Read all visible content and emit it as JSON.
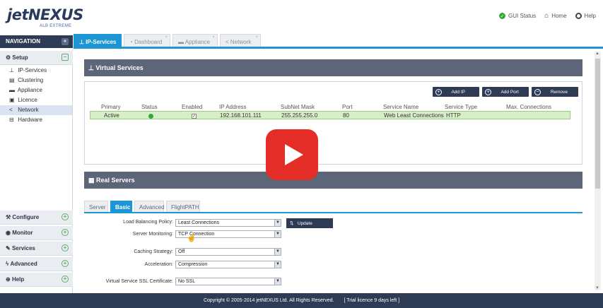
{
  "brand": {
    "logo_main": "jetNEXUS",
    "logo_sub": "ALB EXTREME"
  },
  "toplinks": [
    {
      "label": "GUI Status",
      "icon": "check-circle-icon"
    },
    {
      "label": "Home",
      "icon": "home-icon"
    },
    {
      "label": "Help",
      "icon": "lifebuoy-icon"
    }
  ],
  "nav": {
    "header": "NAVIGATION",
    "collapse_label": "«",
    "setup": {
      "label": "Setup",
      "toggle": "−"
    },
    "setup_items": [
      {
        "label": "IP-Services",
        "icon": "network-icon"
      },
      {
        "label": "Clustering",
        "icon": "server-icon"
      },
      {
        "label": "Appliance",
        "icon": "appliance-icon"
      },
      {
        "label": "Licence",
        "icon": "licence-icon"
      },
      {
        "label": "Network",
        "icon": "share-icon"
      },
      {
        "label": "Hardware",
        "icon": "hardware-icon"
      }
    ],
    "sections": [
      {
        "label": "Configure",
        "icon": "configure-icon",
        "toggle": "+"
      },
      {
        "label": "Monitor",
        "icon": "eye-icon",
        "toggle": "+"
      },
      {
        "label": "Services",
        "icon": "wrench-icon",
        "toggle": "+"
      },
      {
        "label": "Advanced",
        "icon": "bolt-icon",
        "toggle": "+"
      },
      {
        "label": "Help",
        "icon": "lifebuoy-icon",
        "toggle": "+"
      }
    ]
  },
  "tabs": [
    {
      "label": "IP-Services",
      "icon": "network-icon",
      "active": true
    },
    {
      "label": "Dashboard",
      "icon": "dashboard-icon",
      "active": false
    },
    {
      "label": "Appliance",
      "icon": "appliance-icon",
      "active": false
    },
    {
      "label": "Network",
      "icon": "share-icon",
      "active": false
    }
  ],
  "virtual_services": {
    "title": "Virtual Services",
    "buttons": {
      "add_ip": "Add IP",
      "add_port": "Add Port",
      "remove": "Remove"
    },
    "columns": [
      "Primary",
      "Status",
      "Enabled",
      "IP Address",
      "SubNet Mask",
      "Port",
      "Service Name",
      "Service Type",
      "Max. Connections"
    ],
    "rows": [
      {
        "primary": "Active",
        "status": "green",
        "enabled": "✓",
        "ip": "192.168.101.111",
        "mask": "255.255.255.0",
        "port": "80",
        "name": "Web Least Connections",
        "type": "HTTP",
        "max": ""
      }
    ]
  },
  "real_servers": {
    "title": "Real Servers",
    "tabs": [
      "Server",
      "Basic",
      "Advanced",
      "FlightPATH"
    ],
    "active_tab": "Basic",
    "update_label": "Update",
    "fields": [
      {
        "label": "Load Balancing Policy:",
        "value": "Least Connections"
      },
      {
        "label": "Server Monitoring:",
        "value": "TCP Connection"
      },
      {
        "label": "Caching Strategy:",
        "value": "Off"
      },
      {
        "label": "Acceleration:",
        "value": "Compression"
      },
      {
        "label": "Virtual Service SSL Certificate:",
        "value": "No SSL"
      }
    ]
  },
  "footer": {
    "copyright": "Copyright © 2005-2014 jetNEXUS Ltd. All Rights Reserved.",
    "trial": "[ Trial licence 9 days left ]"
  },
  "colors": {
    "accent": "#1c96d4",
    "navy": "#2e3b55",
    "panel": "#5d6679",
    "row_green": "#d7efc6",
    "play_red": "#e52d27"
  }
}
